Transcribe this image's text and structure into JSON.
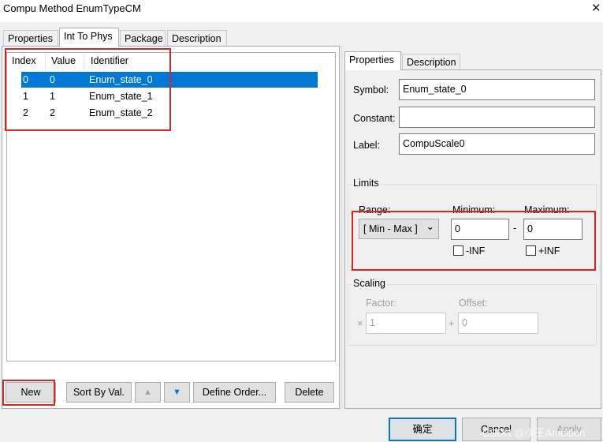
{
  "window": {
    "title": "Compu Method EnumTypeCM",
    "close_glyph": "✕"
  },
  "left_tabs": [
    "Properties",
    "Int To Phys",
    "Package",
    "Description"
  ],
  "table": {
    "headers": [
      "Index",
      "Value",
      "Identifier"
    ],
    "rows": [
      {
        "index": "0",
        "value": "0",
        "identifier": "Enum_state_0",
        "selected": true
      },
      {
        "index": "1",
        "value": "1",
        "identifier": "Enum_state_1",
        "selected": false
      },
      {
        "index": "2",
        "value": "2",
        "identifier": "Enum_state_2",
        "selected": false
      }
    ]
  },
  "list_buttons": {
    "new": "New",
    "sort": "Sort By Val.",
    "up_glyph": "▲",
    "down_glyph": "▼",
    "define_order": "Define Order...",
    "delete": "Delete"
  },
  "right_tabs": [
    "Properties",
    "Description"
  ],
  "props": {
    "symbol_label": "Symbol:",
    "symbol_value": "Enum_state_0",
    "constant_label": "Constant:",
    "constant_value": "",
    "label_label": "Label:",
    "label_value": "CompuScale0"
  },
  "limits": {
    "title": "Limits",
    "range_label": "Range:",
    "range_value": "[ Min - Max ]",
    "range_glyph": "⌄",
    "min_label": "Minimum:",
    "min_value": "0",
    "dash": "-",
    "max_label": "Maximum:",
    "max_value": "0",
    "neg_inf": "-INF",
    "pos_inf": "+INF"
  },
  "scaling": {
    "title": "Scaling",
    "factor_label": "Factor:",
    "factor_value": "1",
    "factor_prefix": "×",
    "offset_label": "Offset:",
    "offset_value": "0",
    "offset_prefix": "+"
  },
  "footer": {
    "ok": "确定",
    "cancel": "Cancel",
    "apply": "Apply",
    "watermark": "CSDN @小王Ambition"
  },
  "colors": {
    "accent": "#0078d7",
    "highlight_box": "#d6262b"
  }
}
